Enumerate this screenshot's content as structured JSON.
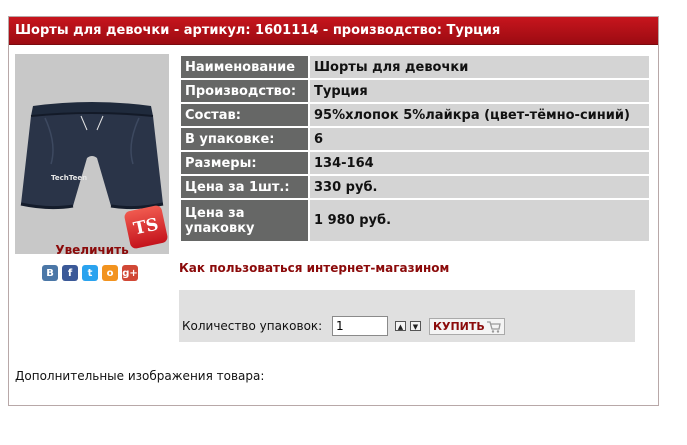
{
  "title": "Шорты для девочки - артикул: 1601114 - производство: Турция",
  "photo": {
    "enlarge_label": "Увеличить",
    "logo_text": "TS"
  },
  "social": [
    {
      "name": "vk",
      "glyph": "B",
      "color": "#4b77a7"
    },
    {
      "name": "facebook",
      "glyph": "f",
      "color": "#3b5998"
    },
    {
      "name": "twitter",
      "glyph": "t",
      "color": "#2aa3ef"
    },
    {
      "name": "odnoklassniki",
      "glyph": "o",
      "color": "#f2931f"
    },
    {
      "name": "google-plus",
      "glyph": "g+",
      "color": "#d14836"
    }
  ],
  "properties": [
    {
      "label": "Наименование",
      "value": "Шорты для девочки"
    },
    {
      "label": "Производство:",
      "value": "Турция"
    },
    {
      "label": "Состав:",
      "value": "95%хлопок 5%лайкра (цвет-тёмно-синий)"
    },
    {
      "label": "В упаковке:",
      "value": "6"
    },
    {
      "label": "Размеры:",
      "value": "134-164"
    },
    {
      "label": "Цена за 1шт.:",
      "value": "330 руб."
    },
    {
      "label": "Цена за упаковку",
      "value": "1 980 руб."
    }
  ],
  "howto_link": "Как пользоваться интернет-магазином",
  "order": {
    "qty_label": "Количество упаковок:",
    "qty_value": "1",
    "buy_label": "КУПИТЬ"
  },
  "extra_images_label": "Дополнительные изображения товара:"
}
